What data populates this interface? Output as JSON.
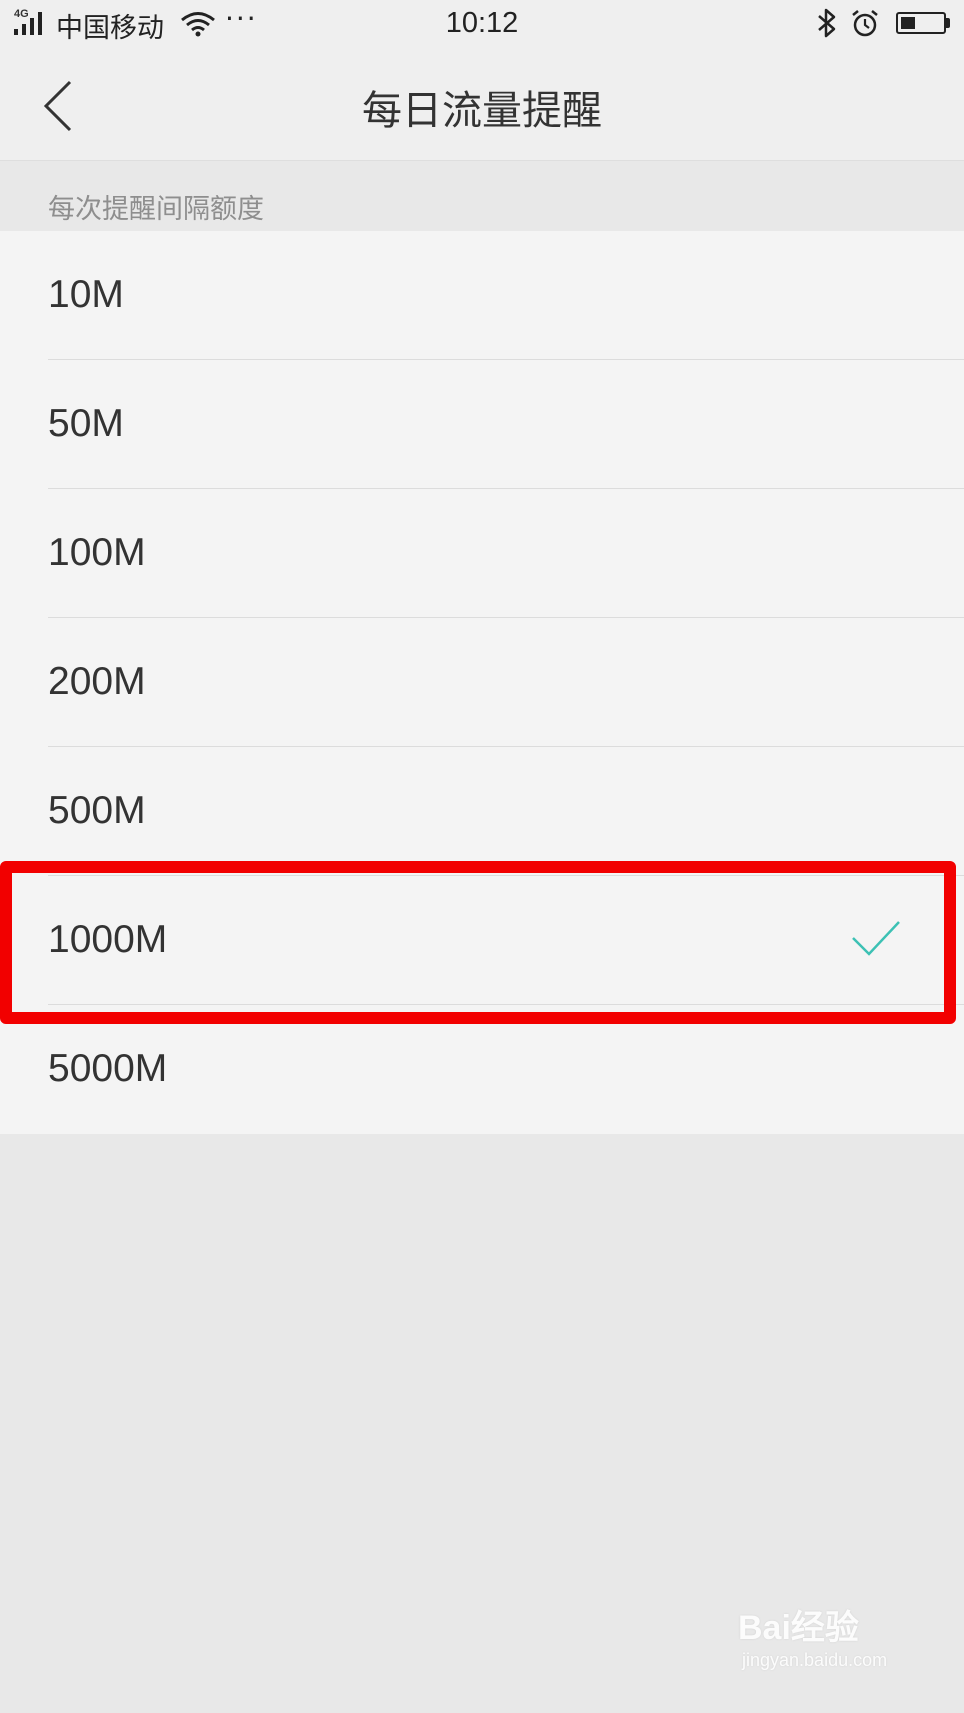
{
  "status_bar": {
    "network": "4G",
    "carrier": "中国移动",
    "more": "···",
    "time": "10:12",
    "battery_level": 0.35
  },
  "header": {
    "title": "每日流量提醒"
  },
  "section": {
    "title": "每次提醒间隔额度"
  },
  "options": [
    {
      "label": "10M",
      "selected": false
    },
    {
      "label": "50M",
      "selected": false
    },
    {
      "label": "100M",
      "selected": false
    },
    {
      "label": "200M",
      "selected": false
    },
    {
      "label": "500M",
      "selected": false
    },
    {
      "label": "1000M",
      "selected": true
    },
    {
      "label": "5000M",
      "selected": false
    }
  ],
  "colors": {
    "accent": "#3cc1b4",
    "highlight": "#f20000"
  },
  "watermark": {
    "logo": "Bai经验",
    "url": "jingyan.baidu.com"
  }
}
